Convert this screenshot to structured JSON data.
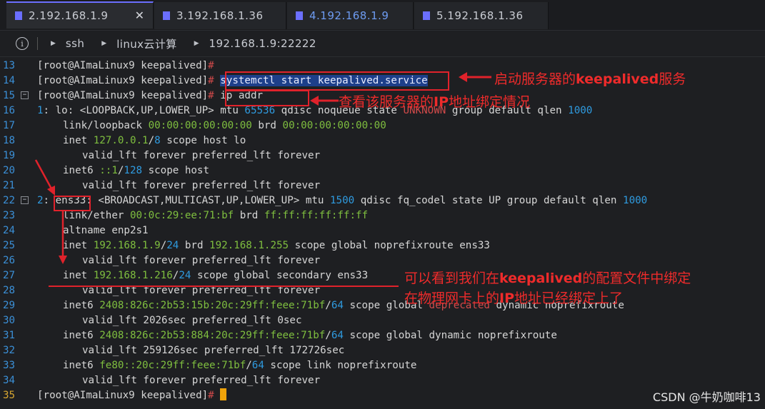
{
  "tabs": [
    {
      "label": "2.192.168.1.9",
      "color": "#6b6fff",
      "active": true,
      "close": "✕"
    },
    {
      "label": "3.192.168.1.36",
      "color": "#6b6fff"
    },
    {
      "label": "4.192.168.1.9",
      "color": "#6b6fff"
    },
    {
      "label": "5.192.168.1.36",
      "color": "#6b6fff"
    }
  ],
  "breadcrumb": {
    "items": [
      "ssh",
      "linux云计算",
      "192.168.1.9:22222"
    ]
  },
  "terminal": {
    "lines": [
      {
        "n": "13",
        "t": "[root@AImaLinux9 keepalived]#"
      },
      {
        "n": "14",
        "t": "[root@AImaLinux9 keepalived]# systemctl start keepalived.service"
      },
      {
        "n": "15",
        "t": "[root@AImaLinux9 keepalived]# ip addr"
      },
      {
        "n": "16",
        "t": "1: lo: <LOOPBACK,UP,LOWER_UP> mtu 65536 qdisc noqueue state UNKNOWN group default qlen 1000"
      },
      {
        "n": "17",
        "t": "link/loopback 00:00:00:00:00:00 brd 00:00:00:00:00:00"
      },
      {
        "n": "18",
        "t": "inet 127.0.0.1/8 scope host lo"
      },
      {
        "n": "19",
        "t": "valid_lft forever preferred_lft forever"
      },
      {
        "n": "20",
        "t": "inet6 ::1/128 scope host"
      },
      {
        "n": "21",
        "t": "valid_lft forever preferred_lft forever"
      },
      {
        "n": "22",
        "t": "2: ens33: <BROADCAST,MULTICAST,UP,LOWER_UP> mtu 1500 qdisc fq_codel state UP group default qlen 1000"
      },
      {
        "n": "23",
        "t": "link/ether 00:0c:29:ee:71:bf brd ff:ff:ff:ff:ff:ff"
      },
      {
        "n": "24",
        "t": "altname enp2s1"
      },
      {
        "n": "25",
        "t": "inet 192.168.1.9/24 brd 192.168.1.255 scope global noprefixroute ens33"
      },
      {
        "n": "26",
        "t": "valid_lft forever preferred_lft forever"
      },
      {
        "n": "27",
        "t": "inet 192.168.1.216/24 scope global secondary ens33"
      },
      {
        "n": "28",
        "t": "valid_lft forever preferred_lft forever"
      },
      {
        "n": "29",
        "t": "inet6 2408:826c:2b53:15b:20c:29ff:feee:71bf/64 scope global deprecated dynamic noprefixroute"
      },
      {
        "n": "30",
        "t": "valid_lft 2026sec preferred_lft 0sec"
      },
      {
        "n": "31",
        "t": "inet6 2408:826c:2b53:884:20c:29ff:feee:71bf/64 scope global dynamic noprefixroute"
      },
      {
        "n": "32",
        "t": "valid_lft 259126sec preferred_lft 172726sec"
      },
      {
        "n": "33",
        "t": "inet6 fe80::20c:29ff:feee:71bf/64 scope link noprefixroute"
      },
      {
        "n": "34",
        "t": "valid_lft forever preferred_lft forever"
      },
      {
        "n": "35",
        "t": "[root@AImaLinux9 keepalived]#"
      }
    ]
  },
  "annotations": {
    "a1_pre": "启动服务器的",
    "a1_bold": "keepalived",
    "a1_post": "服务",
    "a2_pre": "查看该服务器的",
    "a2_bold": "IP",
    "a2_post": "地址绑定情况",
    "a3_pre": "可以看到我们在",
    "a3_bold": "keepalived",
    "a3_post": "的配置文件中绑定",
    "a4_pre": "在物理网卡上的",
    "a4_bold": "IP",
    "a4_post": "地址已经绑定上了"
  },
  "watermark": "CSDN @牛奶咖啡13"
}
